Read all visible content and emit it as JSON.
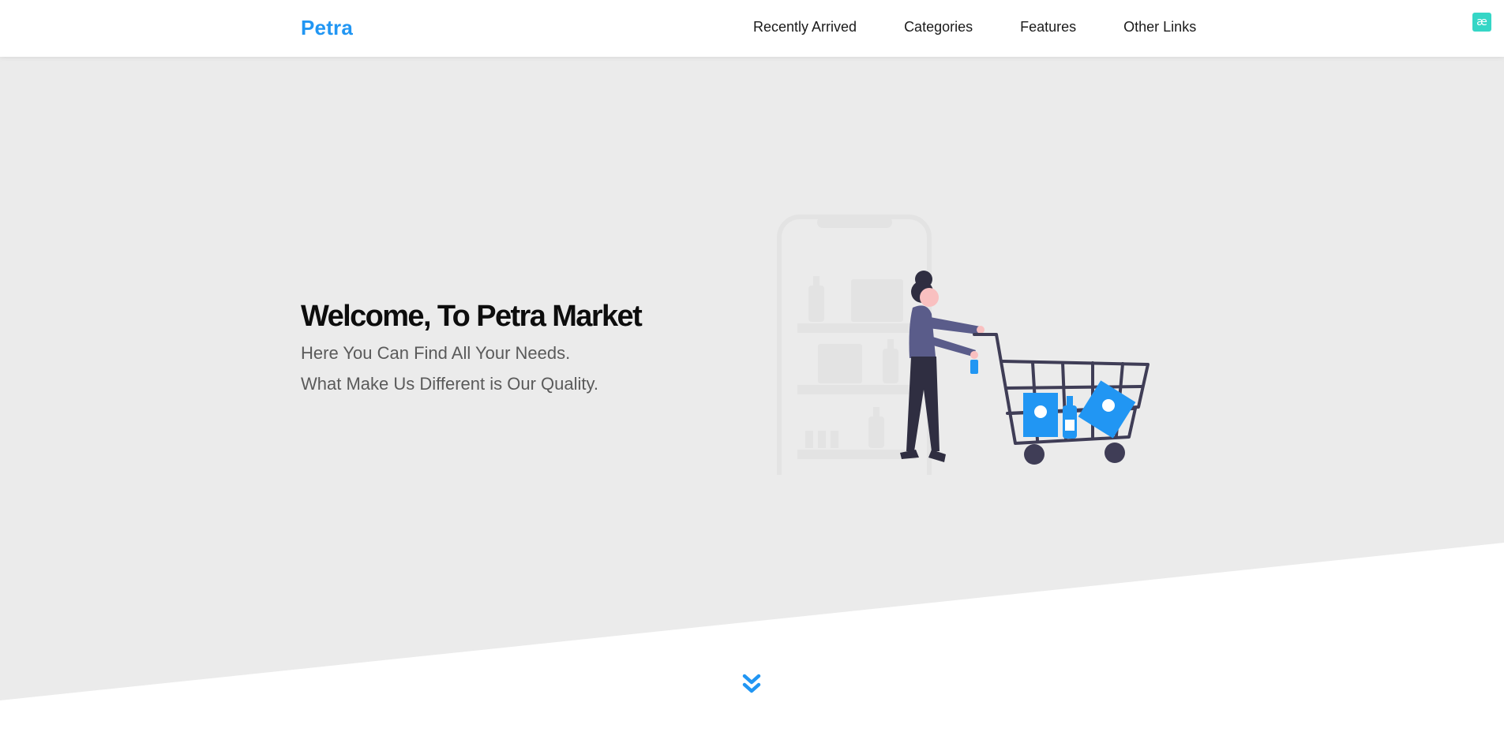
{
  "nav": {
    "brand": "Petra",
    "links": [
      "Recently Arrived",
      "Categories",
      "Features",
      "Other Links"
    ],
    "badge_text": "æ"
  },
  "hero": {
    "title": "Welcome, To Petra Market",
    "lines": [
      "Here You Can Find All Your Needs.",
      "What Make Us Different is Our Quality."
    ],
    "illustration": "woman-pushing-shopping-cart-illustration",
    "scroll_icon": "double-chevron-down-icon"
  },
  "colors": {
    "accent": "#2196f3",
    "hero_background": "#ebebeb",
    "badge": "#35d6c6",
    "illustration_dark": "#3f3d56"
  }
}
